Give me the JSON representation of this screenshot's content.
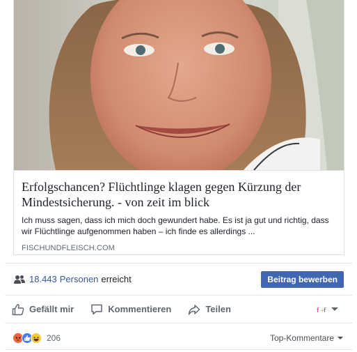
{
  "link_preview": {
    "image_alt": "Frau mit braunen Haaren",
    "headline": "Erfolgschancen? Flüchtlinge klagen gegen Kürzung der Mindestsicherung. - von zeit im blick",
    "description": "Ich muss sagen, dass ich mich doch gewundert habe. Es ist ja gut und richtig, dass wir Flüchtlinge aufgenommen haben – ich finde es allerdings ...",
    "domain": "FISCHUNDFLEISCH.COM"
  },
  "reach": {
    "icon": "people-icon",
    "count": "18.443",
    "persons_label": "Personen",
    "reached_label": "erreicht",
    "boost_button": "Beitrag bewerben"
  },
  "actions": {
    "like": "Gefällt mir",
    "comment": "Kommentieren",
    "share": "Teilen"
  },
  "reactions": {
    "icons": [
      "angry-icon",
      "like-icon",
      "haha-icon"
    ],
    "colors": {
      "angry": "#f0643c",
      "like": "#4a7bf5",
      "haha": "#f7c744"
    },
    "count": "206",
    "sort_label": "Top-Kommentare"
  },
  "colors": {
    "link": "#365899",
    "button": "#4267b2",
    "muted": "#606770",
    "border": "#dddfe2"
  }
}
